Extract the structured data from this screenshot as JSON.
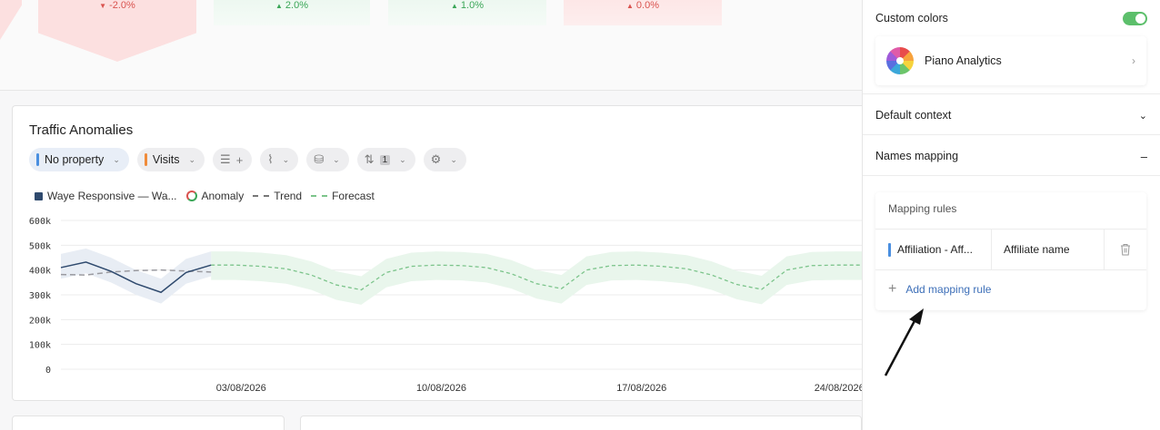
{
  "kpis": [
    {
      "value": "-2.0%",
      "dir": "down",
      "tone": "red"
    },
    {
      "value": "2.0%",
      "dir": "up",
      "tone": "green"
    },
    {
      "value": "1.0%",
      "dir": "up",
      "tone": "green"
    },
    {
      "value": "0.0%",
      "dir": "up",
      "tone": "red"
    }
  ],
  "card": {
    "title": "Traffic Anomalies",
    "toolbar": {
      "property": "No property",
      "metric": "Visits",
      "sort_badge": "1"
    },
    "legend": {
      "series": "Waye Responsive — Wa...",
      "anomaly": "Anomaly",
      "trend": "Trend",
      "forecast": "Forecast"
    }
  },
  "chart_data": {
    "type": "line",
    "y_ticks": [
      "600k",
      "500k",
      "400k",
      "300k",
      "200k",
      "100k",
      "0"
    ],
    "ylim": [
      0,
      600000
    ],
    "x_ticks": [
      "03/08/2026",
      "10/08/2026",
      "17/08/2026",
      "24/08/2026"
    ],
    "series": [
      {
        "name": "Waye Responsive — Wa...",
        "x": [
          0,
          1,
          2,
          3,
          4,
          5,
          6
        ],
        "values": [
          410000,
          432000,
          395000,
          345000,
          310000,
          390000,
          420000
        ]
      },
      {
        "name": "Trend",
        "x": [
          0,
          1,
          2,
          3,
          4,
          5,
          6
        ],
        "values": [
          382000,
          380000,
          392000,
          398000,
          400000,
          396000,
          392000
        ]
      },
      {
        "name": "Forecast",
        "x": [
          6,
          7,
          8,
          9,
          10,
          11,
          12,
          13,
          14,
          15,
          16,
          17,
          18,
          19,
          20,
          21,
          22,
          23,
          24,
          25,
          26,
          27,
          28,
          29,
          30,
          31,
          32
        ],
        "values": [
          420000,
          420000,
          415000,
          405000,
          380000,
          340000,
          320000,
          390000,
          415000,
          420000,
          418000,
          410000,
          385000,
          345000,
          325000,
          400000,
          418000,
          420000,
          415000,
          405000,
          380000,
          342000,
          322000,
          400000,
          418000,
          420000,
          420000
        ]
      }
    ],
    "grid": true,
    "legend_position": "top-left"
  },
  "panel": {
    "custom_colors_label": "Custom colors",
    "custom_colors_on": true,
    "brand_name": "Piano Analytics",
    "default_context_label": "Default context",
    "names_mapping_label": "Names mapping",
    "mapping_rules_title": "Mapping rules",
    "rule_source": "Affiliation - Aff...",
    "rule_target": "Affiliate name",
    "add_rule_label": "Add mapping rule"
  }
}
